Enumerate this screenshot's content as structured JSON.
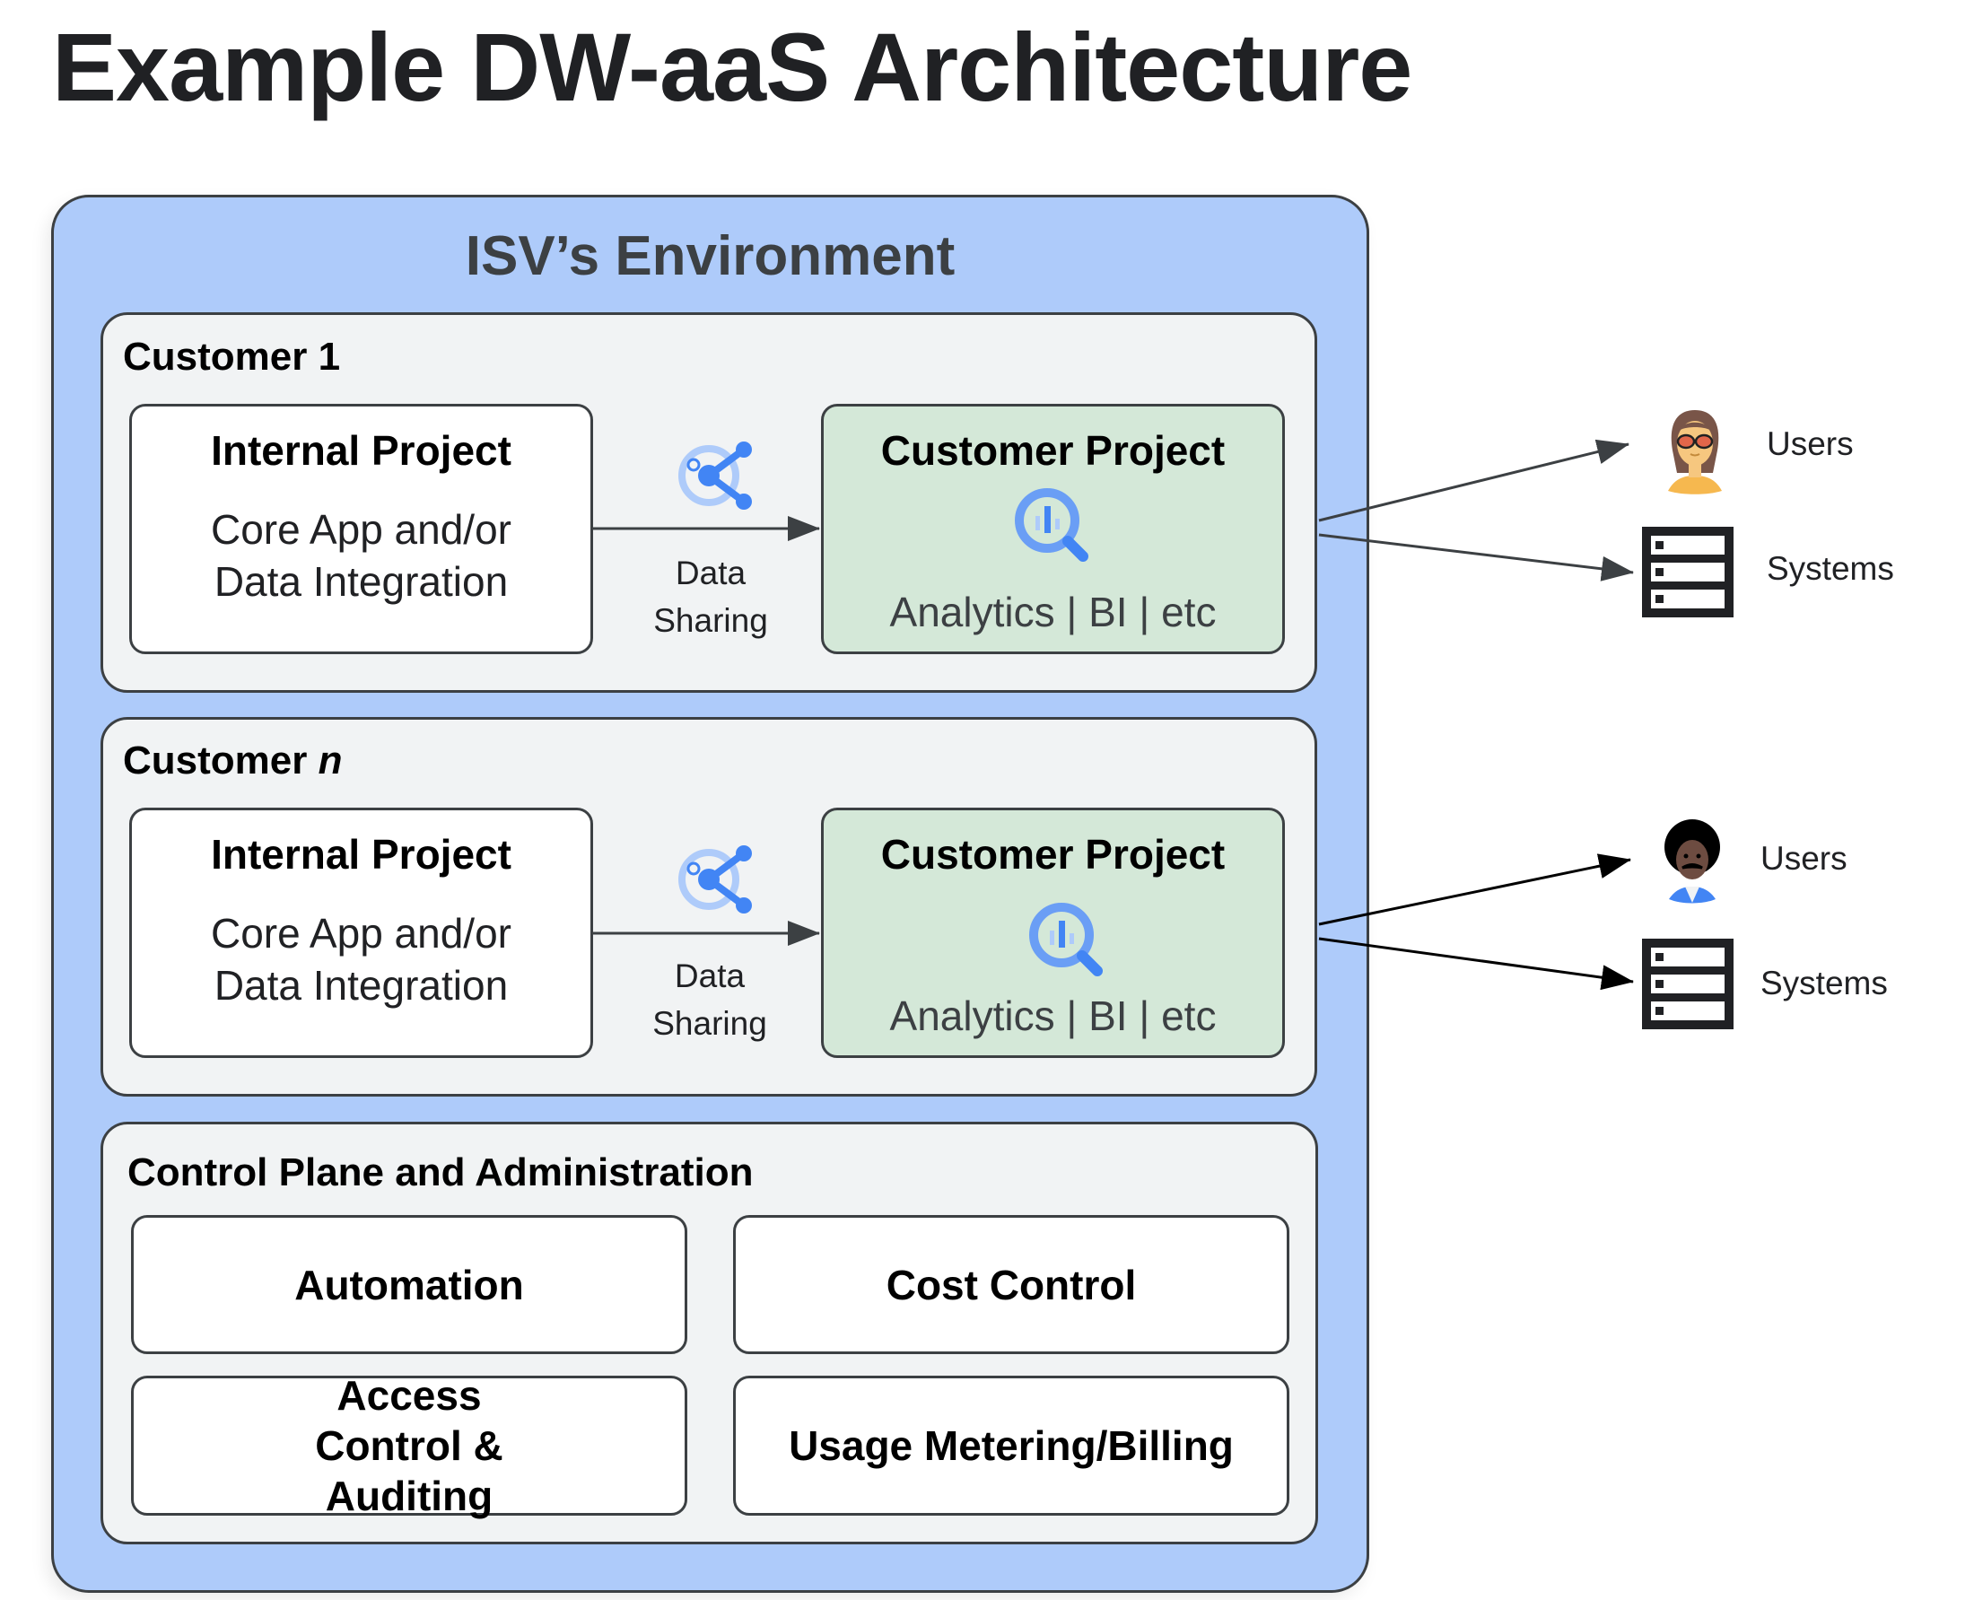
{
  "title": "Example DW-aaS Architecture",
  "environment": {
    "title": "ISV’s Environment",
    "customers": [
      {
        "label_prefix": "Customer",
        "label_suffix": "1",
        "internal_project": {
          "title": "Internal Project",
          "line1": "Core App and/or",
          "line2": "Data Integration"
        },
        "data_sharing": {
          "line1": "Data",
          "line2": "Sharing",
          "icon": "analytics-hub-share-icon"
        },
        "customer_project": {
          "title": "Customer Project",
          "body": "Analytics | BI | etc",
          "icon": "bigquery-icon"
        },
        "consumers": [
          {
            "label": "Users",
            "icon": "user-avatar-woman-icon"
          },
          {
            "label": "Systems",
            "icon": "server-rack-icon"
          }
        ]
      },
      {
        "label_prefix": "Customer",
        "label_suffix": "n",
        "internal_project": {
          "title": "Internal Project",
          "line1": "Core App and/or",
          "line2": "Data Integration"
        },
        "data_sharing": {
          "line1": "Data",
          "line2": "Sharing",
          "icon": "analytics-hub-share-icon"
        },
        "customer_project": {
          "title": "Customer Project",
          "body": "Analytics | BI | etc",
          "icon": "bigquery-icon"
        },
        "consumers": [
          {
            "label": "Users",
            "icon": "user-avatar-man-icon"
          },
          {
            "label": "Systems",
            "icon": "server-rack-icon"
          }
        ]
      }
    ],
    "control_plane": {
      "title": "Control Plane and Administration",
      "items": [
        "Automation",
        "Cost Control",
        "Access Control & Auditing",
        "Usage Metering/Billing"
      ]
    }
  },
  "colors": {
    "environment_bg": "#aecbfa",
    "panel_bg": "#f1f3f4",
    "customer_project_bg": "#d4e8d8",
    "icon_blue": "#4285f4",
    "icon_light_blue": "#aecbfa",
    "outline": "#3c4043"
  }
}
